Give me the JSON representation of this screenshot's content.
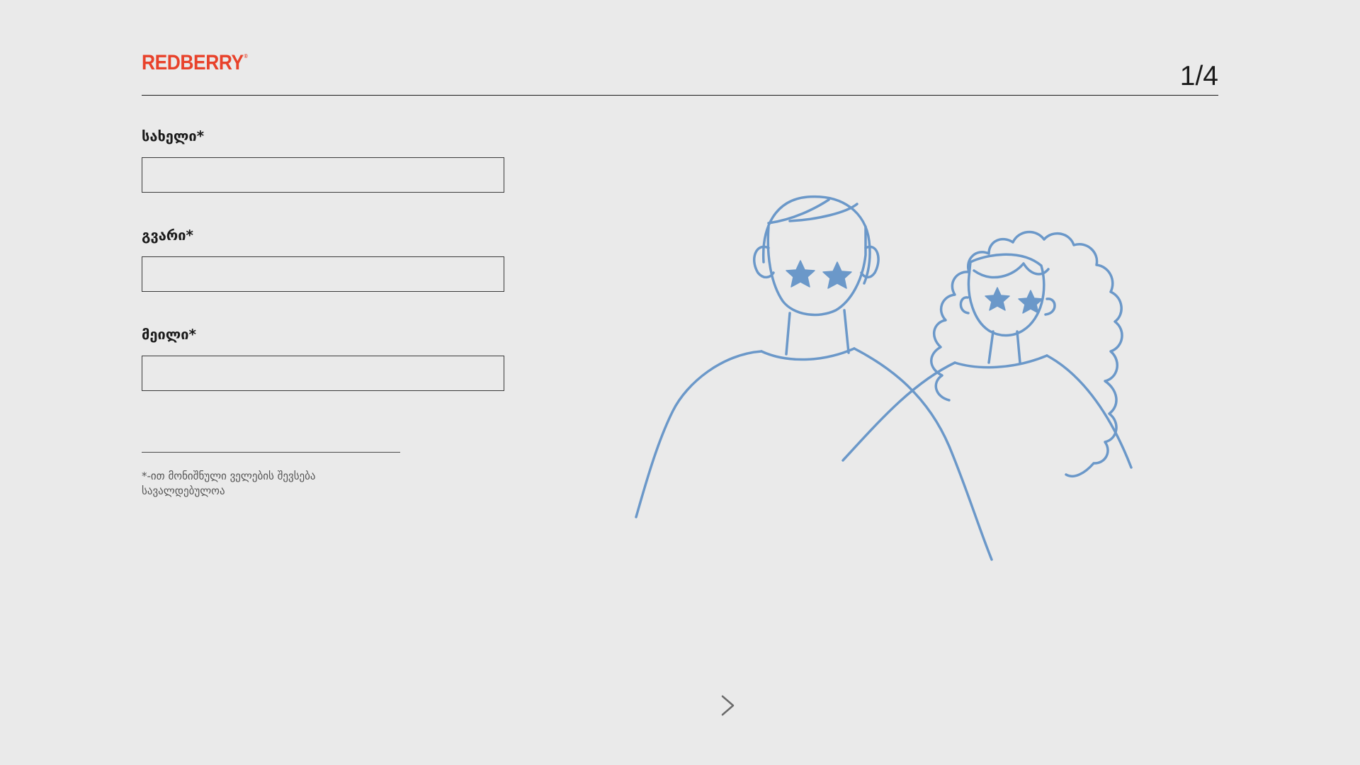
{
  "brand": {
    "logo_text": "REDBERRY",
    "logo_mark": "®",
    "color": "#e8422b"
  },
  "header": {
    "page_counter": "1/4"
  },
  "form": {
    "fields": [
      {
        "label": "სახელი*",
        "value": ""
      },
      {
        "label": "გვარი*",
        "value": ""
      },
      {
        "label": "მეილი*",
        "value": ""
      }
    ],
    "required_note": "*-ით მონიშნული ველების შევსება სავალდებულოა"
  },
  "illustration": {
    "icon": "two-people-star-eyes-illustration",
    "stroke_color": "#6b98c9"
  },
  "navigation": {
    "next_icon": "chevron-right-icon"
  }
}
